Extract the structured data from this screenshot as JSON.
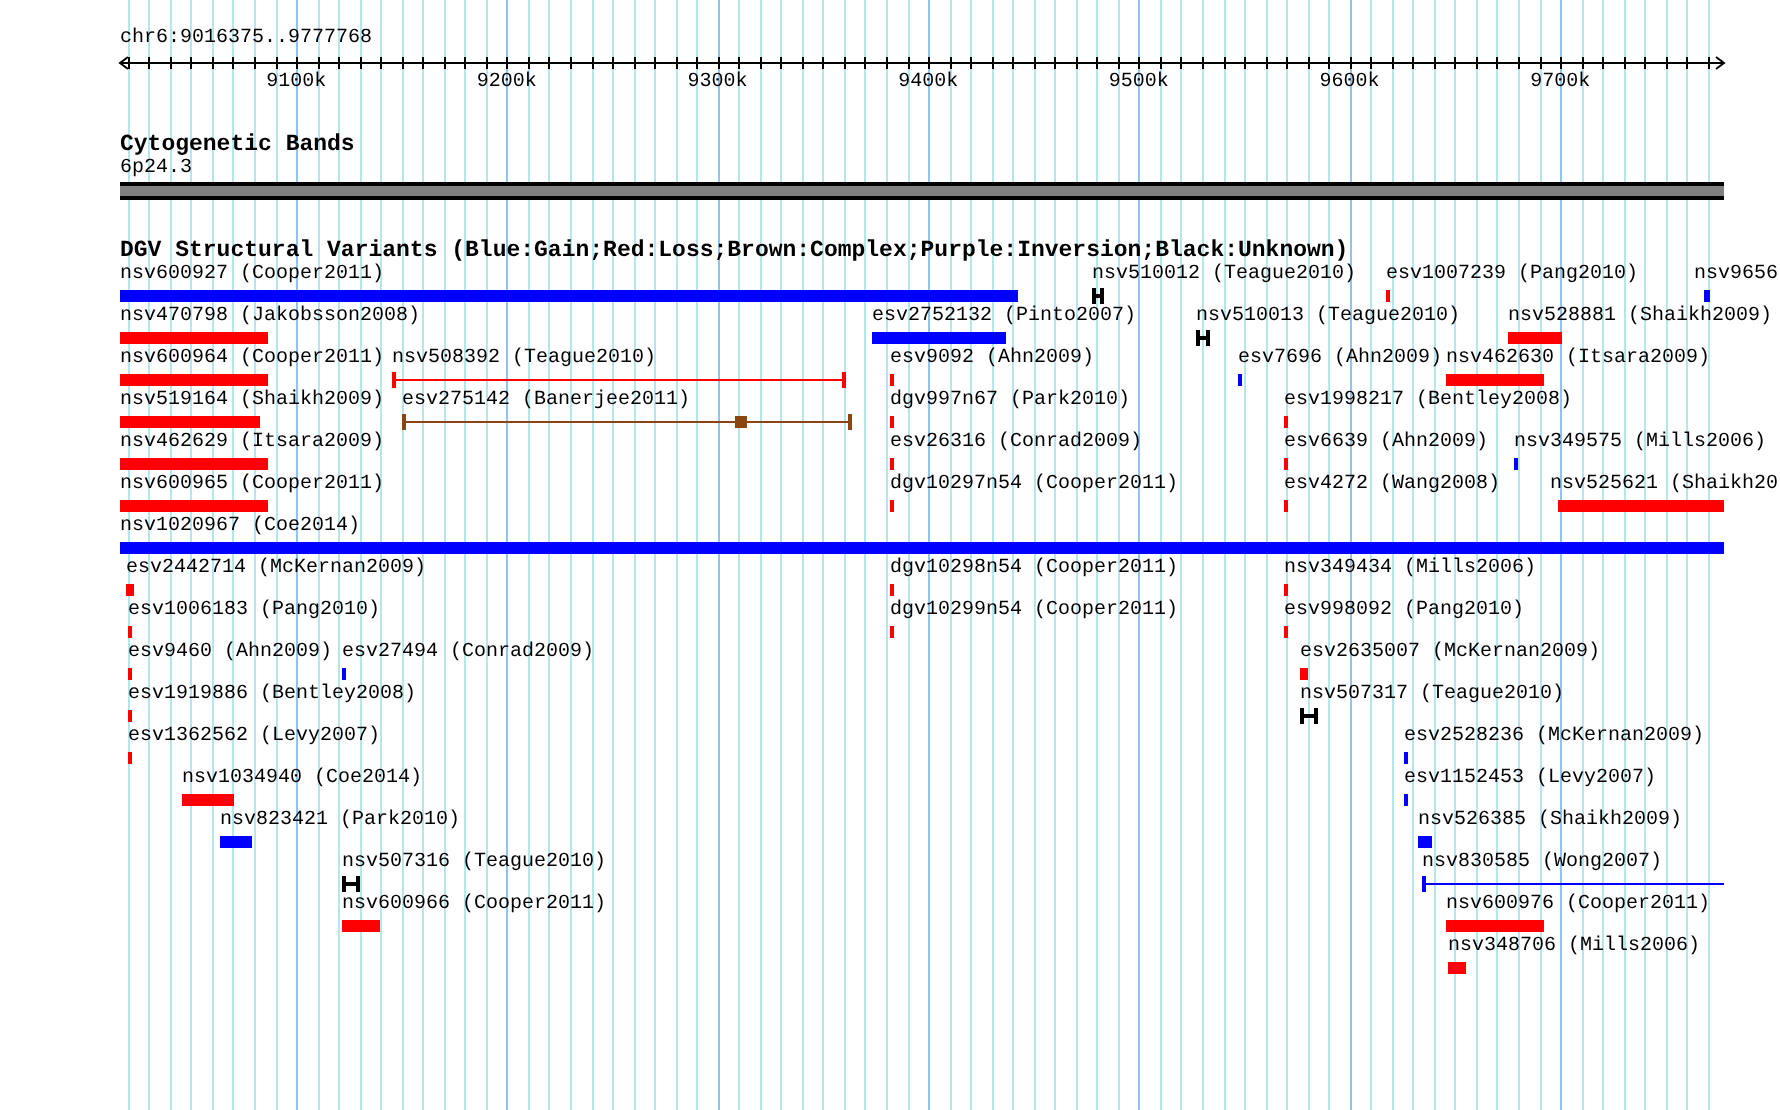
{
  "ruler": {
    "location": "chr6:9016375..9777768",
    "tick_labels": [
      "9100k",
      "9200k",
      "9300k",
      "9400k",
      "9500k",
      "9600k",
      "9700k"
    ]
  },
  "cytoband_track": {
    "title": "Cytogenetic Bands",
    "band": "6p24.3"
  },
  "dgv_track": {
    "title": "DGV Structural Variants (Blue:Gain;Red:Loss;Brown:Complex;Purple:Inversion;Black:Unknown)",
    "rows": [
      {
        "variants": [
          {
            "label": "nsv600927 (Cooper2011)",
            "color": "#0000ff",
            "kind": "bar"
          },
          {
            "label": "nsv510012 (Teague2010)",
            "color": "#000000",
            "kind": "interval"
          },
          {
            "label": "esv1007239 (Pang2010)",
            "color": "#ff0000",
            "kind": "bar"
          },
          {
            "label": "nsv9656",
            "color": "#0000ff",
            "kind": "bar"
          }
        ]
      },
      {
        "variants": [
          {
            "label": "nsv470798 (Jakobsson2008)",
            "color": "#ff0000",
            "kind": "bar"
          },
          {
            "label": "esv2752132 (Pinto2007)",
            "color": "#0000ff",
            "kind": "bar"
          },
          {
            "label": "nsv510013 (Teague2010)",
            "color": "#000000",
            "kind": "interval"
          },
          {
            "label": "nsv528881 (Shaikh2009)",
            "color": "#ff0000",
            "kind": "bar"
          }
        ]
      },
      {
        "variants": [
          {
            "label": "nsv600964 (Cooper2011)",
            "color": "#ff0000",
            "kind": "bar"
          },
          {
            "label": "nsv508392 (Teague2010)",
            "color": "#ff0000",
            "kind": "interval"
          },
          {
            "label": "esv9092 (Ahn2009)",
            "color": "#ff0000",
            "kind": "bar"
          },
          {
            "label": "esv7696 (Ahn2009)",
            "color": "#0000ff",
            "kind": "bar"
          },
          {
            "label": "nsv462630 (Itsara2009)",
            "color": "#ff0000",
            "kind": "bar"
          }
        ]
      },
      {
        "variants": [
          {
            "label": "nsv519164 (Shaikh2009)",
            "color": "#ff0000",
            "kind": "bar"
          },
          {
            "label": "esv275142 (Banerjee2011)",
            "color": "#8b4513",
            "kind": "interval"
          },
          {
            "label": "dgv997n67 (Park2010)",
            "color": "#ff0000",
            "kind": "bar"
          },
          {
            "label": "esv1998217 (Bentley2008)",
            "color": "#ff0000",
            "kind": "bar"
          }
        ]
      },
      {
        "variants": [
          {
            "label": "nsv462629 (Itsara2009)",
            "color": "#ff0000",
            "kind": "bar"
          },
          {
            "label": "esv26316 (Conrad2009)",
            "color": "#ff0000",
            "kind": "bar"
          },
          {
            "label": "esv6639 (Ahn2009)",
            "color": "#ff0000",
            "kind": "bar"
          },
          {
            "label": "nsv349575 (Mills2006)",
            "color": "#0000ff",
            "kind": "bar"
          }
        ]
      },
      {
        "variants": [
          {
            "label": "nsv600965 (Cooper2011)",
            "color": "#ff0000",
            "kind": "bar"
          },
          {
            "label": "dgv10297n54 (Cooper2011)",
            "color": "#ff0000",
            "kind": "bar"
          },
          {
            "label": "esv4272 (Wang2008)",
            "color": "#ff0000",
            "kind": "bar"
          },
          {
            "label": "nsv525621 (Shaikh20",
            "color": "#ff0000",
            "kind": "bar"
          }
        ]
      },
      {
        "variants": [
          {
            "label": "nsv1020967 (Coe2014)",
            "color": "#0000ff",
            "kind": "bar"
          }
        ]
      },
      {
        "variants": [
          {
            "label": "esv2442714 (McKernan2009)",
            "color": "#ff0000",
            "kind": "bar"
          },
          {
            "label": "dgv10298n54 (Cooper2011)",
            "color": "#ff0000",
            "kind": "bar"
          },
          {
            "label": "nsv349434 (Mills2006)",
            "color": "#ff0000",
            "kind": "bar"
          }
        ]
      },
      {
        "variants": [
          {
            "label": "esv1006183 (Pang2010)",
            "color": "#ff0000",
            "kind": "bar"
          },
          {
            "label": "dgv10299n54 (Cooper2011)",
            "color": "#ff0000",
            "kind": "bar"
          },
          {
            "label": "esv998092 (Pang2010)",
            "color": "#ff0000",
            "kind": "bar"
          }
        ]
      },
      {
        "variants": [
          {
            "label": "esv9460 (Ahn2009)",
            "color": "#ff0000",
            "kind": "bar"
          },
          {
            "label": "esv27494 (Conrad2009)",
            "color": "#0000ff",
            "kind": "bar"
          },
          {
            "label": "esv2635007 (McKernan2009)",
            "color": "#ff0000",
            "kind": "bar"
          }
        ]
      },
      {
        "variants": [
          {
            "label": "esv1919886 (Bentley2008)",
            "color": "#ff0000",
            "kind": "bar"
          },
          {
            "label": "nsv507317 (Teague2010)",
            "color": "#000000",
            "kind": "interval"
          }
        ]
      },
      {
        "variants": [
          {
            "label": "esv1362562 (Levy2007)",
            "color": "#ff0000",
            "kind": "bar"
          },
          {
            "label": "esv2528236 (McKernan2009)",
            "color": "#0000ff",
            "kind": "bar"
          }
        ]
      },
      {
        "variants": [
          {
            "label": "nsv1034940 (Coe2014)",
            "color": "#ff0000",
            "kind": "bar"
          },
          {
            "label": "esv1152453 (Levy2007)",
            "color": "#0000ff",
            "kind": "bar"
          }
        ]
      },
      {
        "variants": [
          {
            "label": "nsv823421 (Park2010)",
            "color": "#0000ff",
            "kind": "bar"
          },
          {
            "label": "nsv526385 (Shaikh2009)",
            "color": "#0000ff",
            "kind": "bar"
          }
        ]
      },
      {
        "variants": [
          {
            "label": "nsv507316 (Teague2010)",
            "color": "#000000",
            "kind": "interval"
          },
          {
            "label": "nsv830585 (Wong2007)",
            "color": "#0000ff",
            "kind": "interval"
          }
        ]
      },
      {
        "variants": [
          {
            "label": "nsv600966 (Cooper2011)",
            "color": "#ff0000",
            "kind": "bar"
          },
          {
            "label": "nsv600976 (Cooper2011)",
            "color": "#ff0000",
            "kind": "bar"
          }
        ]
      },
      {
        "variants": [
          {
            "label": "nsv348706 (Mills2006)",
            "color": "#ff0000",
            "kind": "bar"
          }
        ]
      }
    ]
  }
}
